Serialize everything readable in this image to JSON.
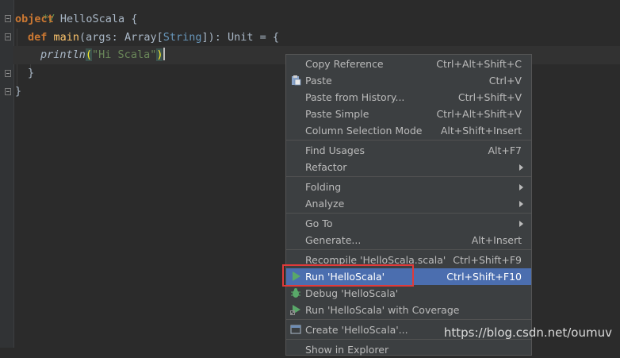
{
  "editor": {
    "line0": "*/",
    "line1": {
      "kw": "object",
      "name": " HelloScala ",
      "brace": "{"
    },
    "line2": {
      "kw": "def",
      "fn": "main",
      "p1": "(args: Array[",
      "ty": "String",
      "p2": "]): Unit = {"
    },
    "line3": {
      "fn": "println",
      "open": "(",
      "str": "\"Hi Scala\"",
      "close": ")"
    },
    "line4": "}",
    "line5": "}"
  },
  "menu": {
    "items": [
      {
        "label": "Copy Reference",
        "shortcut": "Ctrl+Alt+Shift+C"
      },
      {
        "label": "Paste",
        "shortcut": "Ctrl+V",
        "icon": "clipboard-icon"
      },
      {
        "label": "Paste from History...",
        "shortcut": "Ctrl+Shift+V"
      },
      {
        "label": "Paste Simple",
        "shortcut": "Ctrl+Alt+Shift+V"
      },
      {
        "label": "Column Selection Mode",
        "shortcut": "Alt+Shift+Insert"
      },
      {
        "label": "Find Usages",
        "shortcut": "Alt+F7"
      },
      {
        "label": "Refactor",
        "submenu": true
      },
      {
        "label": "Folding",
        "submenu": true
      },
      {
        "label": "Analyze",
        "submenu": true
      },
      {
        "label": "Go To",
        "submenu": true
      },
      {
        "label": "Generate...",
        "shortcut": "Alt+Insert"
      },
      {
        "label": "Recompile 'HelloScala.scala'",
        "shortcut": "Ctrl+Shift+F9"
      },
      {
        "label": "Run 'HelloScala'",
        "shortcut": "Ctrl+Shift+F10",
        "icon": "run-icon",
        "selected": true
      },
      {
        "label": "Debug 'HelloScala'",
        "icon": "debug-icon"
      },
      {
        "label": "Run 'HelloScala' with Coverage",
        "icon": "coverage-icon"
      },
      {
        "label": "Create 'HelloScala'...",
        "icon": "create-config-icon"
      },
      {
        "label": "Show in Explorer"
      }
    ]
  },
  "watermark": "https://blog.csdn.net/oumuv",
  "colors": {
    "selection": "#4b6eaf",
    "highlight_box": "#e03a3a",
    "run_green": "#59a869"
  }
}
